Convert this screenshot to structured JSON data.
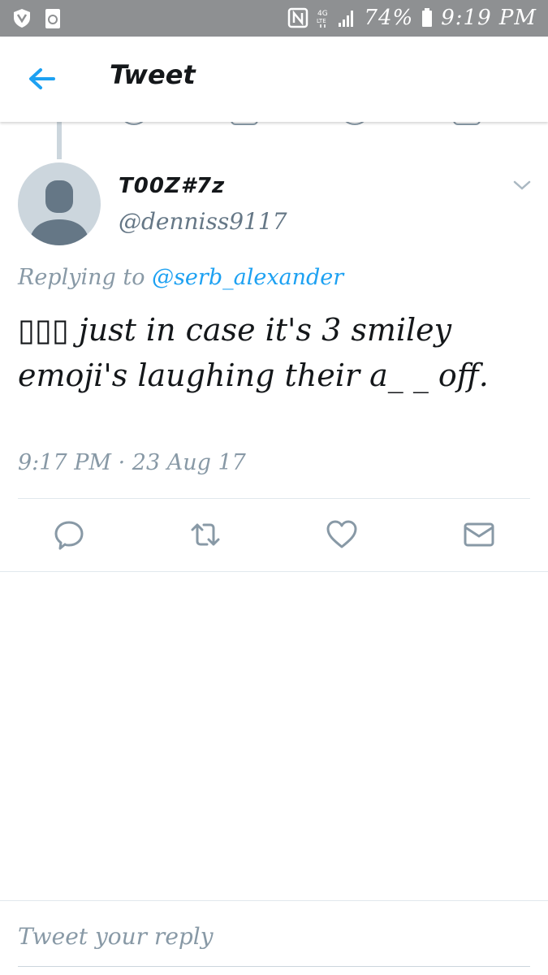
{
  "status_bar": {
    "battery": "74%",
    "time": "9:19 PM",
    "icons": [
      "shield-icon",
      "recycle-icon",
      "nfc-icon",
      "4g-lte-icon",
      "signal-icon",
      "battery-icon"
    ]
  },
  "header": {
    "title": "Tweet",
    "back_icon": "back-arrow-icon"
  },
  "tweet": {
    "display_name": "T00Z#7z",
    "username": "@denniss9117",
    "replying_prefix": "Replying to",
    "replying_handle": "@serb_alexander",
    "text": "▯▯▯ just in case it's 3 smiley emoji's laughing their a_ _ off.",
    "timestamp": "9:17 PM · 23 Aug 17",
    "actions": [
      "reply-icon",
      "retweet-icon",
      "like-icon",
      "direct-message-icon"
    ]
  },
  "reply_box": {
    "placeholder": "Tweet your reply"
  },
  "colors": {
    "accent": "#1da1f2",
    "status_bar": "#8e9092",
    "secondary_text": "#8899a6",
    "avatar_bg": "#ccd6dd",
    "avatar_fg": "#657786"
  }
}
